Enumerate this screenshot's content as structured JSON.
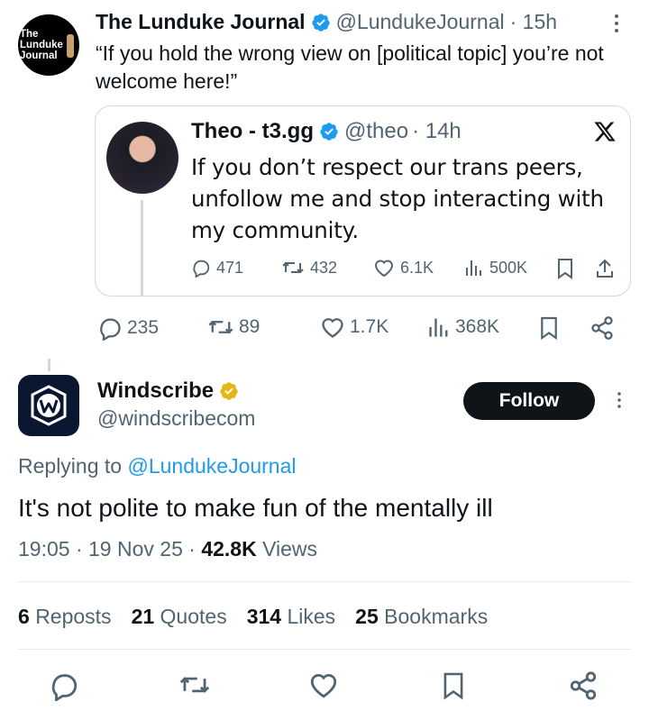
{
  "top_tweet": {
    "avatar_text": "The Lunduke Journal",
    "author_name": "The Lunduke Journal",
    "handle": "@LundukeJournal",
    "time": "· 15h",
    "text": "“If you hold the wrong view on [political topic] you’re not welcome here!”",
    "quote": {
      "author_name": "Theo - t3.gg",
      "handle": "@theo",
      "time": "· 14h",
      "text": "If you don’t respect our trans peers, unfollow me and stop interacting with my community.",
      "replies": "471",
      "reposts": "432",
      "likes": "6.1K",
      "views": "500K"
    },
    "replies": "235",
    "reposts": "89",
    "likes": "1.7K",
    "views": "368K"
  },
  "reply_tweet": {
    "author_name": "Windscribe",
    "handle": "@windscribecom",
    "follow_label": "Follow",
    "replying_prefix": "Replying to",
    "replying_handle": "@LundukeJournal",
    "text": "It's not polite to make fun of the mentally ill",
    "time": "19:05",
    "date": "19 Nov 25",
    "views_count": "42.8K",
    "views_label": "Views",
    "stats": {
      "reposts_count": "6",
      "reposts_label": "Reposts",
      "quotes_count": "21",
      "quotes_label": "Quotes",
      "likes_count": "314",
      "likes_label": "Likes",
      "bookmarks_count": "25",
      "bookmarks_label": "Bookmarks"
    }
  },
  "colors": {
    "verified_blue": "#1d9bf0",
    "verified_gold": "#e2b719",
    "text_primary": "#0f1419",
    "text_secondary": "#536471",
    "link": "#1d9bf0"
  },
  "icons": [
    "verified-badge-icon",
    "more-icon",
    "x-logo-icon",
    "reply-icon",
    "repost-icon",
    "like-icon",
    "views-icon",
    "bookmark-icon",
    "share-icon",
    "windscribe-logo-icon"
  ]
}
